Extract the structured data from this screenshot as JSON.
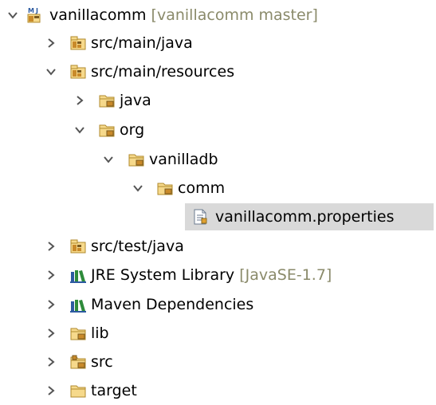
{
  "project_explorer": {
    "items": [
      {
        "label": "vanillacomm",
        "decoration": "[vanillacomm master]",
        "icon": "maven-project-icon",
        "expanded": true
      },
      {
        "label": "src/main/java",
        "icon": "source-folder-icon",
        "expanded": false
      },
      {
        "label": "src/main/resources",
        "icon": "source-folder-icon",
        "expanded": true
      },
      {
        "label": "java",
        "icon": "package-folder-icon",
        "expanded": false
      },
      {
        "label": "org",
        "icon": "package-folder-icon",
        "expanded": true
      },
      {
        "label": "vanilladb",
        "icon": "package-folder-icon",
        "expanded": true
      },
      {
        "label": "comm",
        "icon": "package-folder-icon",
        "expanded": true
      },
      {
        "label": "vanillacomm.properties",
        "icon": "properties-file-icon",
        "selected": true
      },
      {
        "label": "src/test/java",
        "icon": "source-folder-icon",
        "expanded": false
      },
      {
        "label": "JRE System Library",
        "decoration": "[JavaSE-1.7]",
        "icon": "library-icon",
        "expanded": false
      },
      {
        "label": "Maven Dependencies",
        "icon": "library-icon",
        "expanded": false
      },
      {
        "label": "lib",
        "icon": "package-folder-icon",
        "expanded": false
      },
      {
        "label": "src",
        "icon": "source-package-folder-icon",
        "expanded": false
      },
      {
        "label": "target",
        "icon": "plain-folder-icon",
        "expanded": false
      }
    ]
  },
  "colors": {
    "folder_fill": "#f6d98b",
    "folder_stroke": "#b08a2e",
    "library_green": "#2e8b3a",
    "library_blue": "#2c5aa0",
    "selection": "#d9d9d9",
    "decoration_text": "#8a8a6a",
    "twisty": "#555555"
  }
}
